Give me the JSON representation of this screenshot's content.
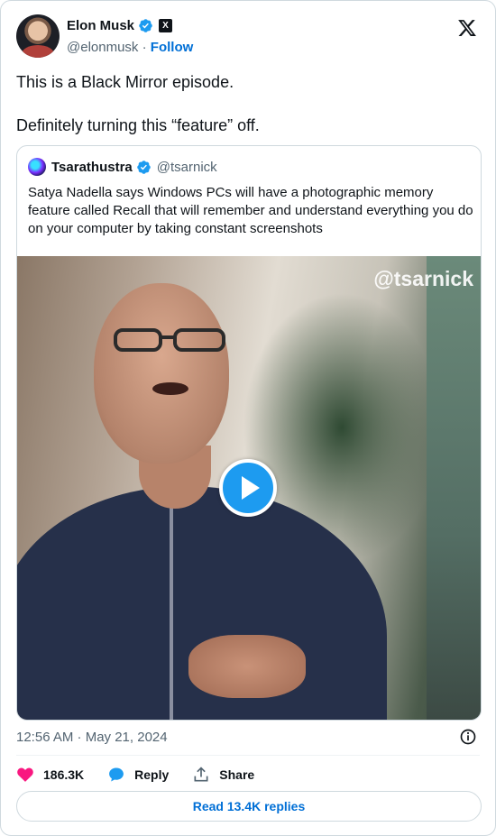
{
  "author": {
    "name": "Elon Musk",
    "handle": "@elonmusk",
    "separator": "·",
    "follow_label": "Follow",
    "x_badge": "X"
  },
  "tweet": {
    "line1": "This is a Black Mirror episode.",
    "line2": "Definitely turning this “feature” off."
  },
  "quote": {
    "name": "Tsarathustra",
    "handle": "@tsarnick",
    "text": "Satya Nadella says Windows PCs will have a photographic memory feature called Recall that will remember and understand everything you do on your computer by taking constant screenshots",
    "video_watermark": "@tsarnick"
  },
  "meta": {
    "timestamp": "12:56 AM · May 21, 2024"
  },
  "actions": {
    "likes": "186.3K",
    "reply_label": "Reply",
    "share_label": "Share"
  },
  "replies_button": "Read 13.4K replies",
  "colors": {
    "accent": "#1d9bf0",
    "link": "#006fd6",
    "like": "#f91880",
    "muted": "#536471"
  },
  "icons": [
    "verified-badge-icon",
    "x-logo-icon",
    "play-icon",
    "info-icon",
    "heart-icon",
    "reply-icon",
    "share-icon"
  ]
}
